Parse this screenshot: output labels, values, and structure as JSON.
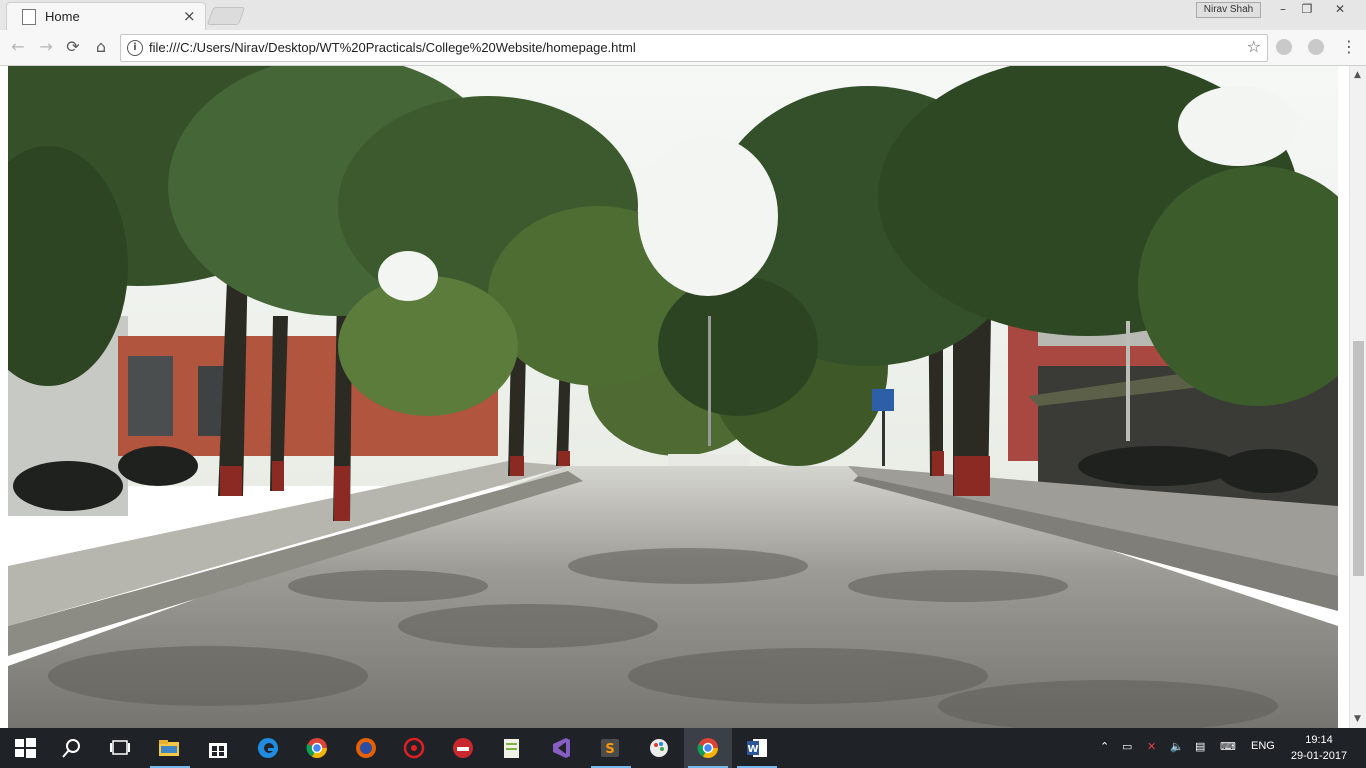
{
  "browser": {
    "tab_title": "Home",
    "tab_close": "×",
    "user_name": "Nirav Shah",
    "window_buttons": {
      "minimize": "–",
      "restore": "❐",
      "close": "✕"
    },
    "nav": {
      "back": "←",
      "forward": "→",
      "reload": "⟳",
      "home": "⌂"
    },
    "url": "file:///C:/Users/Nirav/Desktop/WT%20Practicals/College%20Website/homepage.html",
    "menu_icon": "⋮",
    "extensions": [
      "skype-icon",
      "extension-icon"
    ]
  },
  "page": {
    "image_description": "campus-road-tree-lined-photo"
  },
  "taskbar": {
    "apps": [
      "start",
      "search",
      "task-view",
      "file-explorer",
      "store",
      "edge",
      "chrome",
      "firefox",
      "app-red",
      "app-share",
      "notepad-plus-plus",
      "visual-studio",
      "sublime-text",
      "paint-app",
      "chrome-active",
      "word"
    ],
    "language": "ENG",
    "time": "19:14",
    "date": "29-01-2017"
  },
  "colors": {
    "taskbar_bg": "#1f2328",
    "chrome_bg": "#f7f7f7",
    "accent": "#76b9ed"
  }
}
